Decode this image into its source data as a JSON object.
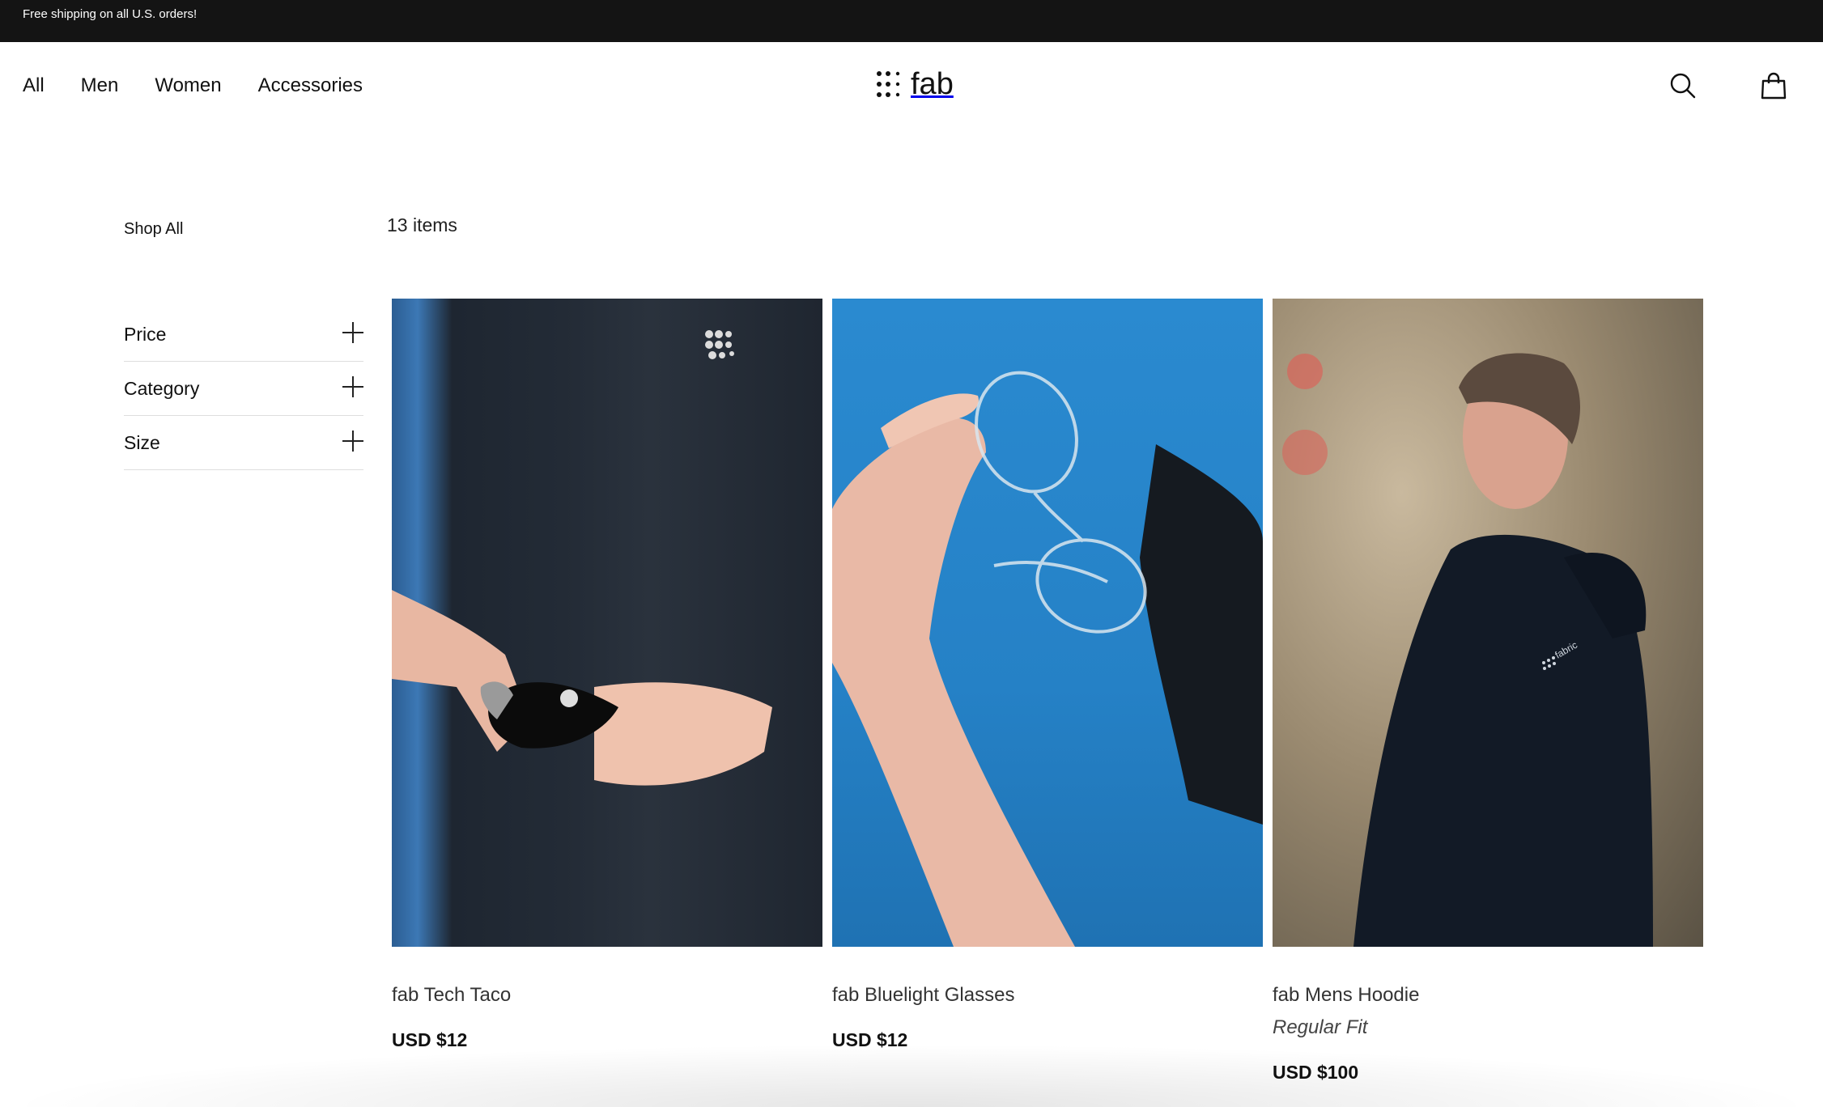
{
  "announcement": {
    "text": "Free shipping on all U.S. orders!"
  },
  "nav": {
    "links": [
      "All",
      "Men",
      "Women",
      "Accessories"
    ],
    "logo_text": "fab",
    "search_icon": "search-icon",
    "cart_icon": "bag-icon"
  },
  "sidebar": {
    "shop_all": "Shop All",
    "filters": [
      {
        "label": "Price",
        "icon": "plus-icon"
      },
      {
        "label": "Category",
        "icon": "plus-icon"
      },
      {
        "label": "Size",
        "icon": "plus-icon"
      }
    ]
  },
  "results": {
    "count_label": "13 items"
  },
  "products": [
    {
      "name": "fab Tech Taco",
      "price": "USD $12"
    },
    {
      "name": "fab Bluelight Glasses",
      "price": "USD $12"
    },
    {
      "name": "fab Mens Hoodie",
      "variant": "Regular Fit",
      "price": "USD $100"
    }
  ],
  "colors": {
    "announcement_bg": "#141414",
    "text": "#111111",
    "divider": "#dedede"
  }
}
